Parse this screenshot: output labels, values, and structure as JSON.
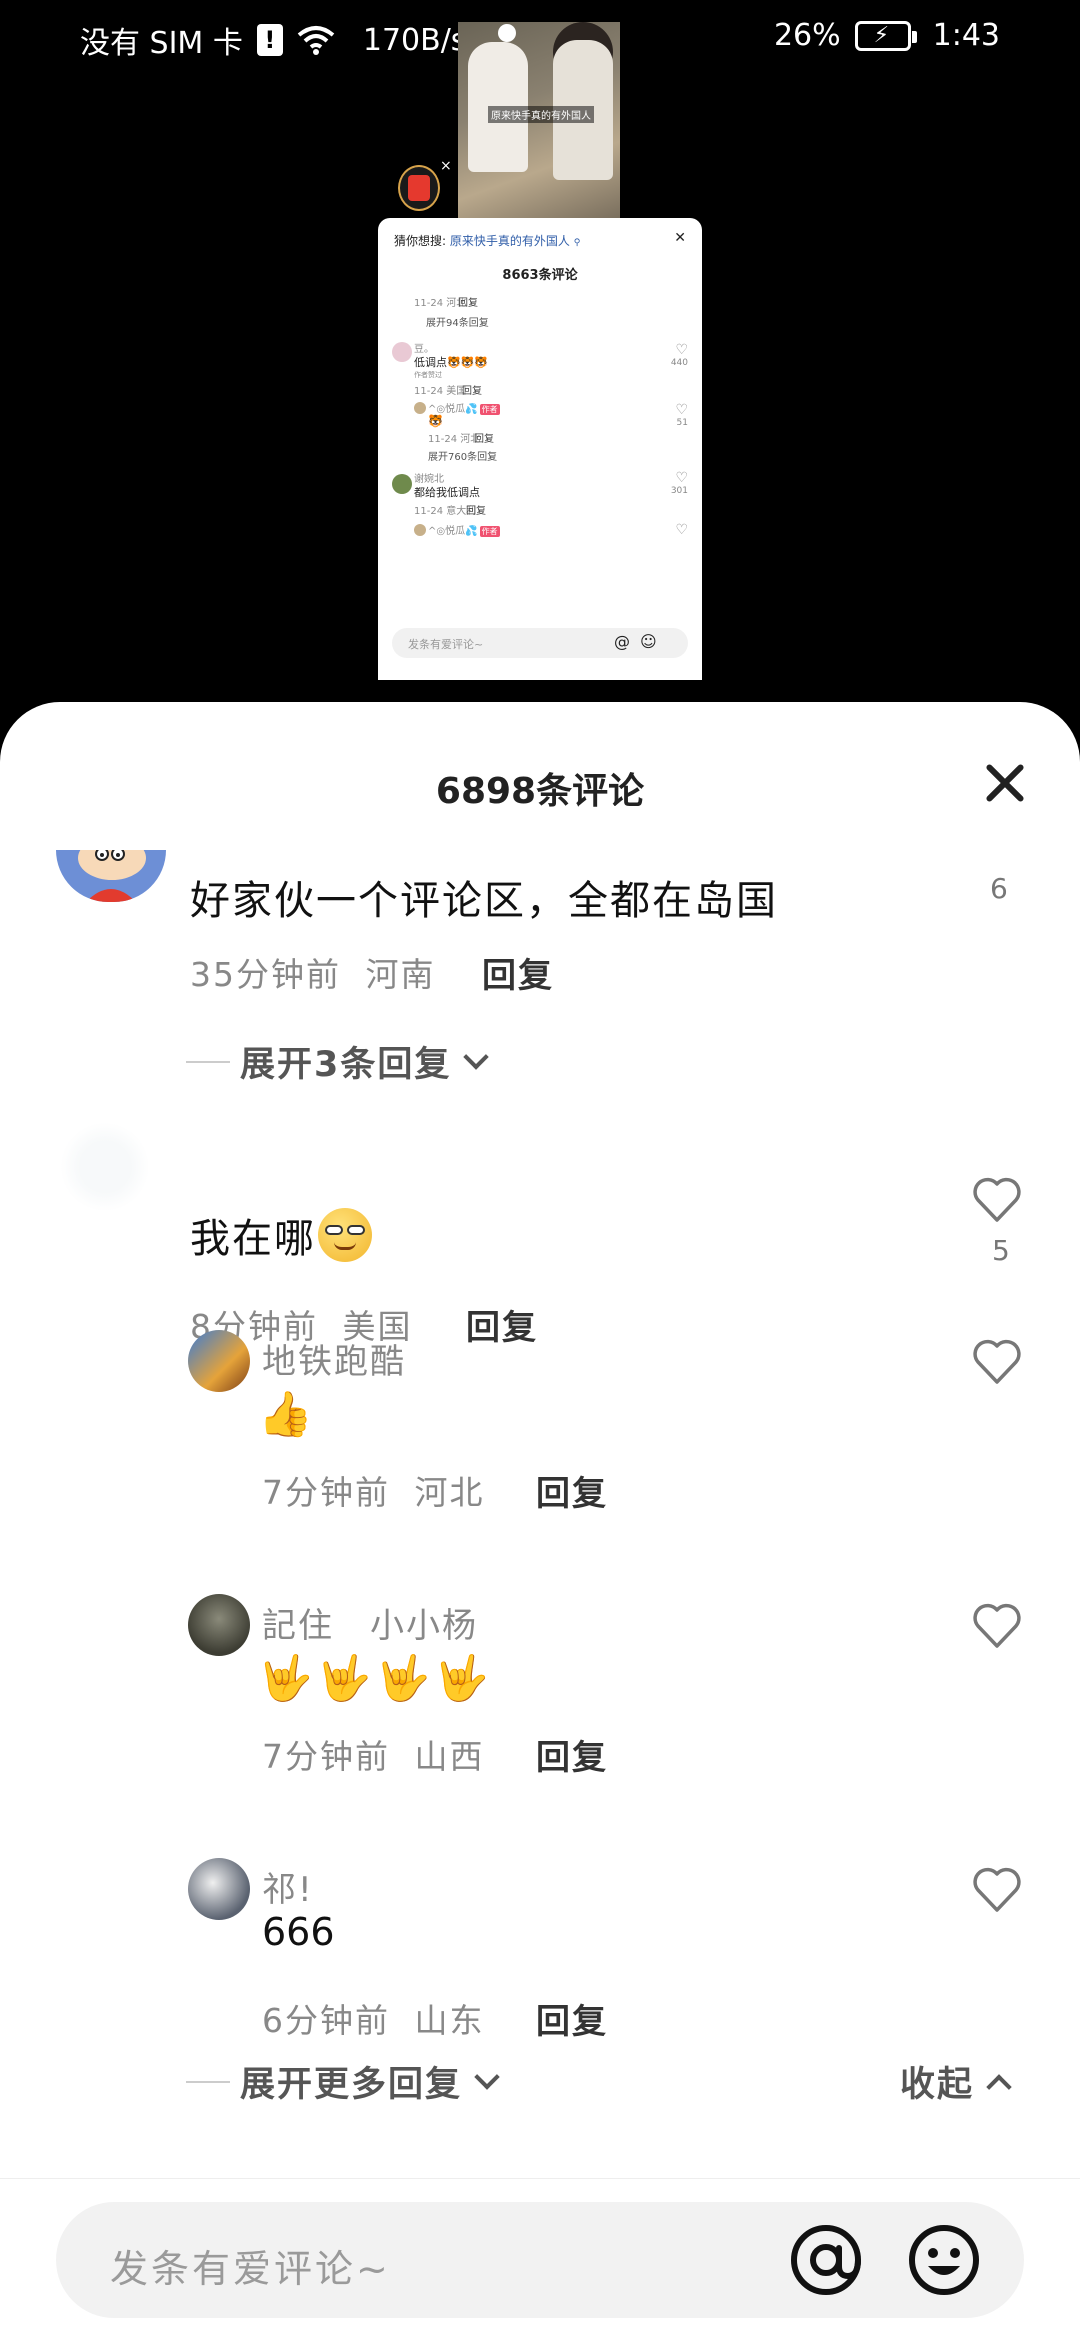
{
  "status_bar": {
    "carrier": "没有 SIM 卡",
    "net_speed": "170B/s",
    "battery": "26%",
    "time": "1:43"
  },
  "background": {
    "video_caption": "原来快手真的有外国人",
    "mini_sheet": {
      "search_hint_prefix": "猜你想搜:",
      "search_hint_keyword": "原来快手真的有外国人",
      "title": "8663条评论",
      "rows": [
        {
          "meta": "11-24 河北",
          "reply": "回复"
        },
        {
          "expand": "展开94条回复"
        },
        {
          "name": "豆。",
          "text": "低调点🐯🐯🐯",
          "sub": "作者赞过",
          "meta": "11-24 美国",
          "reply": "回复",
          "likes": "440"
        },
        {
          "name": "^◎悦瓜💦",
          "tag": "作者",
          "text": "🐯",
          "meta": "11-24 河北",
          "reply": "回复",
          "likes": "51"
        },
        {
          "expand": "展开760条回复"
        },
        {
          "name": "谢婉北",
          "text": "都给我低调点",
          "meta": "11-24 意大利",
          "reply": "回复",
          "likes": "301"
        },
        {
          "name": "^◎悦瓜💦",
          "tag": "作者"
        }
      ],
      "input_placeholder": "发条有爱评论~"
    }
  },
  "sheet": {
    "title": "6898条评论",
    "comments": [
      {
        "text": "好家伙一个评论区，全都在岛国",
        "time": "35分钟前",
        "location": "河南",
        "reply_label": "回复",
        "likes": "6",
        "expand_label": "展开3条回复"
      },
      {
        "text": "我在哪",
        "time": "8分钟前",
        "location": "美国",
        "reply_label": "回复",
        "likes": "5",
        "replies": [
          {
            "name": "地铁跑酷",
            "text": "👍",
            "time": "7分钟前",
            "location": "河北",
            "reply_label": "回复"
          },
          {
            "name": "記住　小小杨",
            "text": "🤟🤟🤟🤟",
            "time": "7分钟前",
            "location": "山西",
            "reply_label": "回复"
          },
          {
            "name": "祁!",
            "text": "666",
            "time": "6分钟前",
            "location": "山东",
            "reply_label": "回复"
          }
        ],
        "expand_more_label": "展开更多回复",
        "collapse_label": "收起"
      }
    ],
    "input_placeholder": "发条有爱评论~"
  },
  "icons": {
    "close": "close-icon",
    "heart": "heart-icon",
    "at": "at-icon",
    "emoji": "smile-icon"
  },
  "colors": {
    "sheet_bg": "#ffffff",
    "backdrop": "#000000",
    "muted_text": "#888888",
    "input_bg": "#f2f2f2"
  }
}
